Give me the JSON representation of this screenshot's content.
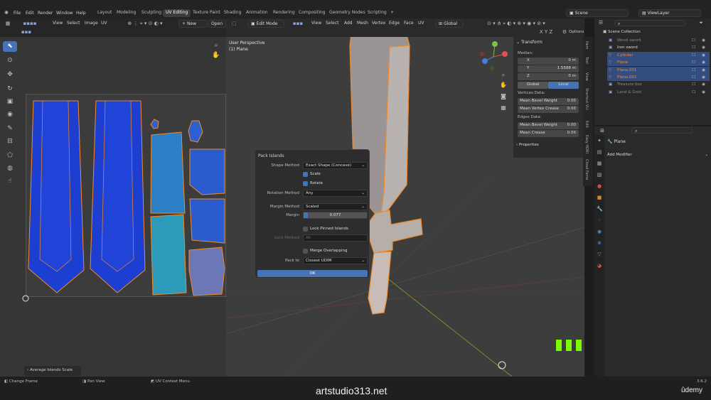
{
  "menus": [
    "File",
    "Edit",
    "Render",
    "Window",
    "Help"
  ],
  "workspaces": [
    {
      "label": "Layout",
      "active": false
    },
    {
      "label": "Modeling",
      "active": false
    },
    {
      "label": "Sculpting",
      "active": false
    },
    {
      "label": "UV Editing",
      "active": true
    },
    {
      "label": "Texture Paint",
      "active": false
    },
    {
      "label": "Shading",
      "active": false
    },
    {
      "label": "Animation",
      "active": false
    },
    {
      "label": "Rendering",
      "active": false
    },
    {
      "label": "Compositing",
      "active": false
    },
    {
      "label": "Geometry Nodes",
      "active": false
    },
    {
      "label": "Scripting",
      "active": false
    }
  ],
  "add_workspace": "+",
  "scene": {
    "label": "Scene",
    "view_layer": "ViewLayer"
  },
  "uv_editor": {
    "menu": [
      "View",
      "Select",
      "Image",
      "UV"
    ],
    "new_button": "New",
    "open_button": "Open",
    "last_operator": "Average Islands Scale"
  },
  "viewport": {
    "mode": "Edit Mode",
    "menu": [
      "View",
      "Select",
      "Add",
      "Mesh",
      "Vertex",
      "Edge",
      "Face",
      "UV"
    ],
    "orientation": "Global",
    "perspective_label": "User Perspective",
    "object_label": "(1) Plane",
    "options_label": "Options",
    "axes": [
      "X",
      "Y",
      "Z"
    ]
  },
  "transform": {
    "header": "Transform",
    "median_label": "Median:",
    "x": {
      "label": "X",
      "value": "0 m"
    },
    "y": {
      "label": "Y",
      "value": "1.5588 m"
    },
    "z": {
      "label": "Z",
      "value": "0 m"
    },
    "global": "Global",
    "local": "Local",
    "vertices_label": "Vertices Data:",
    "bevel": {
      "label": "Mean Bevel Weight",
      "value": "0.00"
    },
    "crease": {
      "label": "Mean Vertex Crease",
      "value": "0.00"
    },
    "edges_label": "Edges Data:",
    "edge_bevel": {
      "label": "Mean Bevel Weight",
      "value": "0.00"
    },
    "edge_crease": {
      "label": "Mean Crease",
      "value": "0.00"
    },
    "properties_label": "Properties"
  },
  "side_tabs": [
    "Item",
    "Tool",
    "View",
    "Shortcut VU:",
    "Edit",
    "Easy HDRI",
    "Cloud Fame"
  ],
  "outliner": {
    "root": "Scene Collection",
    "items": [
      {
        "name": "Wood sword",
        "selected": false,
        "dim": true
      },
      {
        "name": "Iron sword",
        "selected": false,
        "dim": false
      },
      {
        "name": "Cylinder",
        "selected": true,
        "dim": false
      },
      {
        "name": "Plane",
        "selected": true,
        "dim": false
      },
      {
        "name": "Plane.001",
        "selected": true,
        "dim": false
      },
      {
        "name": "Plane.002",
        "selected": true,
        "dim": false
      },
      {
        "name": "Treasure box",
        "selected": false,
        "dim": true
      },
      {
        "name": "Land & Gold",
        "selected": false,
        "dim": true
      }
    ]
  },
  "properties": {
    "object": "Plane",
    "add_modifier": "Add Modifier"
  },
  "pack_islands": {
    "title": "Pack Islands",
    "shape_method": {
      "label": "Shape Method",
      "value": "Exact Shape (Concave)"
    },
    "scale": {
      "label": "Scale",
      "checked": true
    },
    "rotate": {
      "label": "Rotate",
      "checked": true
    },
    "rotation_method": {
      "label": "Rotation Method",
      "value": "Any"
    },
    "margin_method": {
      "label": "Margin Method",
      "value": "Scaled"
    },
    "margin": {
      "label": "Margin",
      "value": "0.077"
    },
    "lock_pinned": {
      "label": "Lock Pinned Islands",
      "checked": false
    },
    "lock_method": {
      "label": "Lock Method",
      "value": "All"
    },
    "merge_overlapping": {
      "label": "Merge Overlapping",
      "checked": false
    },
    "pack_to": {
      "label": "Pack to",
      "value": "Closest UDIM"
    },
    "ok": "OK"
  },
  "status": {
    "change_frame": "Change Frame",
    "pan_view": "Pan View",
    "context_menu": "UV Context Menu",
    "version": "3.6.2"
  },
  "watermark": "artstudio313.net",
  "brand": "ûdemy",
  "colors": {
    "accent": "#4772b3",
    "uv_island": "#1c3fd1",
    "orange": "#f08a2c",
    "selected_row": "#334d80",
    "green_block": "#7cfc00"
  }
}
